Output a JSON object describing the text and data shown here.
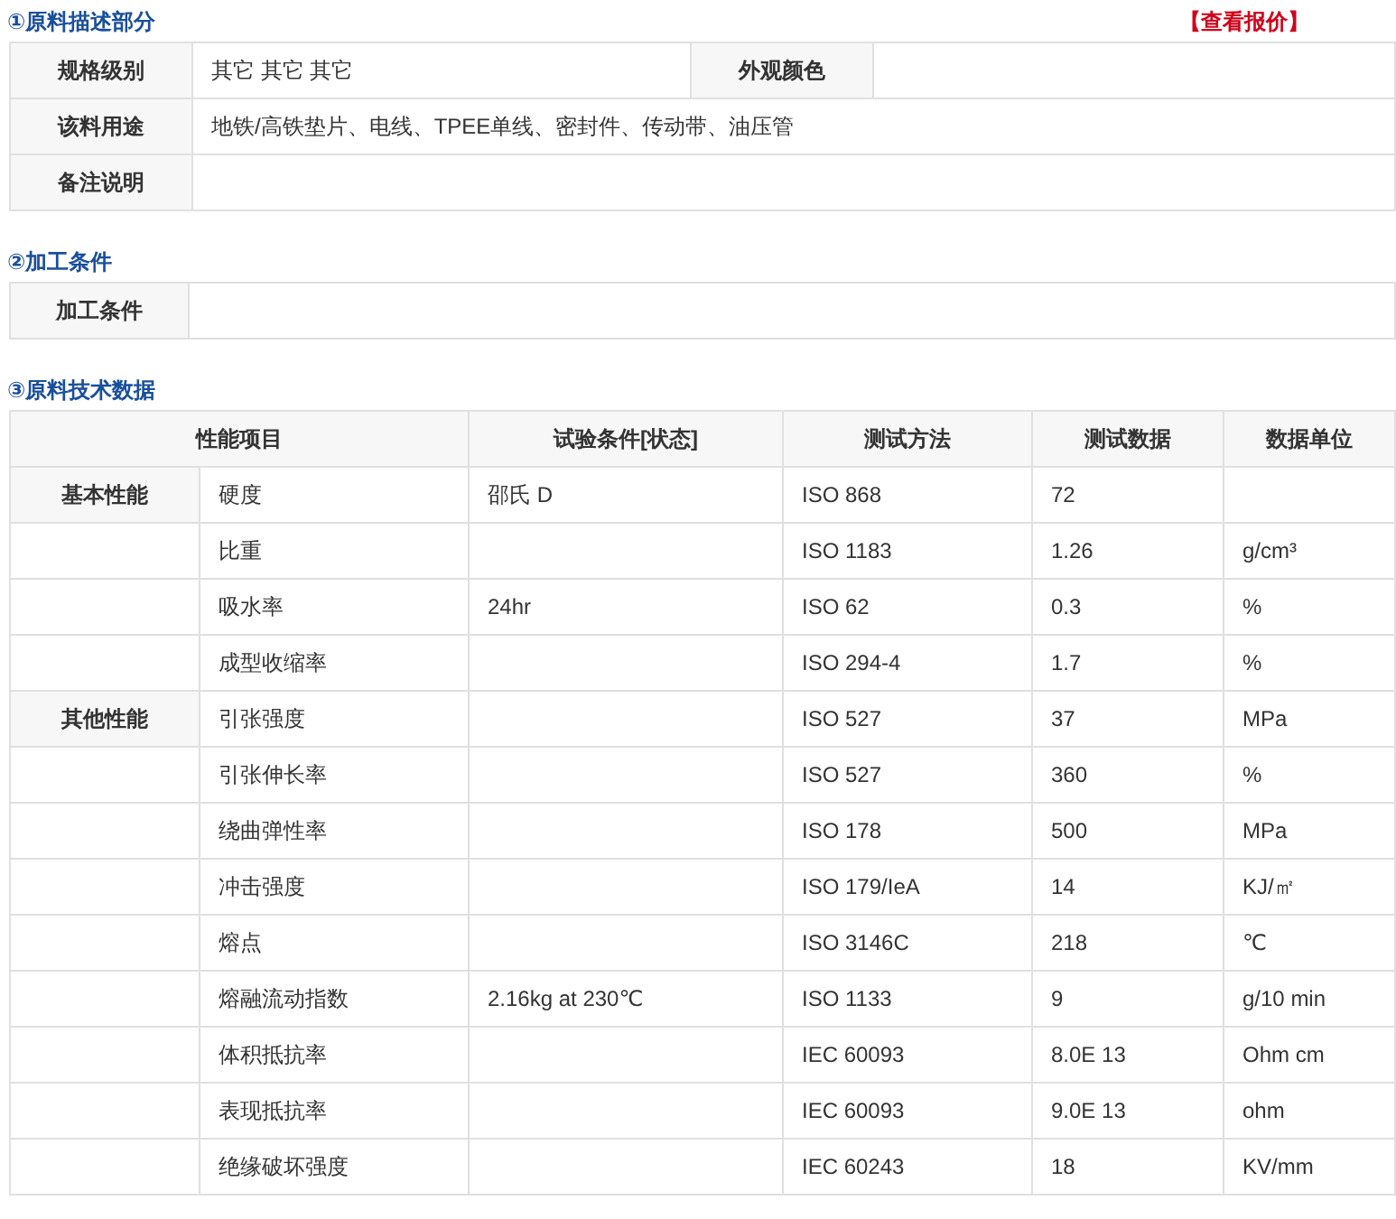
{
  "section1": {
    "title": "①原料描述部分",
    "quote_link": "【查看报价】",
    "rows": [
      {
        "label": "规格级别",
        "value": "其它 其它 其它",
        "label2": "外观颜色"
      },
      {
        "label": "该料用途",
        "value": "地铁/高铁垫片、电线、TPEE单线、密封件、传动带、油压管"
      },
      {
        "label": "备注说明"
      }
    ]
  },
  "section2": {
    "title": "②加工条件",
    "rows": [
      {
        "label": "加工条件"
      }
    ]
  },
  "section3": {
    "title": "③原料技术数据",
    "columns": [
      "性能项目",
      "试验条件[状态]",
      "测试方法",
      "测试数据",
      "数据单位"
    ],
    "rows": [
      {
        "group": "基本性能",
        "item": "硬度",
        "condition": "邵氏 D",
        "method": "ISO 868",
        "value": "72"
      },
      {
        "item": "比重",
        "method": "ISO 1183",
        "value": "1.26",
        "unit": "g/cm³"
      },
      {
        "item": "吸水率",
        "condition": "24hr",
        "method": "ISO 62",
        "value": "0.3",
        "unit": "%"
      },
      {
        "item": "成型收缩率",
        "method": "ISO 294-4",
        "value": "1.7",
        "unit": "%"
      },
      {
        "group": "其他性能",
        "item": "引张强度",
        "method": "ISO 527",
        "value": "37",
        "unit": "MPa"
      },
      {
        "item": "引张伸长率",
        "method": "ISO 527",
        "value": "360",
        "unit": "%"
      },
      {
        "item": "绕曲弹性率",
        "method": "ISO 178",
        "value": "500",
        "unit": "MPa"
      },
      {
        "item": "冲击强度",
        "method": "ISO 179/IeA",
        "value": "14",
        "unit": "KJ/㎡"
      },
      {
        "item": "熔点",
        "method": "ISO 3146C",
        "value": "218",
        "unit": "℃"
      },
      {
        "item": "熔融流动指数",
        "condition": "2.16kg at 230℃",
        "method": "ISO 1133",
        "value": "9",
        "unit": "g/10 min"
      },
      {
        "item": "体积抵抗率",
        "method": "IEC 60093",
        "value": "8.0E 13",
        "unit": "Ohm cm"
      },
      {
        "item": "表现抵抗率",
        "method": "IEC 60093",
        "value": "9.0E 13",
        "unit": "ohm"
      },
      {
        "item": "绝缘破坏强度",
        "method": "IEC 60243",
        "value": "18",
        "unit": "KV/mm"
      }
    ]
  }
}
